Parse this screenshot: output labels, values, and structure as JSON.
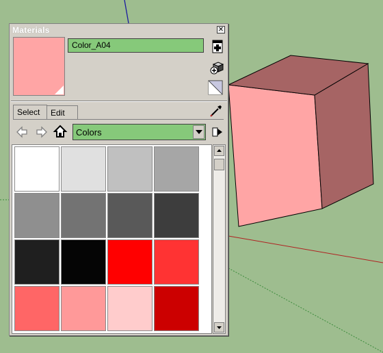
{
  "panel": {
    "title": "Materials",
    "material_name": "Color_A04",
    "current_color": "#ffa5a5"
  },
  "tabs": [
    {
      "label": "Select",
      "active": true
    },
    {
      "label": "Edit",
      "active": false
    }
  ],
  "collection": {
    "selected": "Colors"
  },
  "swatches": [
    "#ffffff",
    "#e0e0e0",
    "#c0c0c0",
    "#a6a6a6",
    "#8f8f8f",
    "#737373",
    "#595959",
    "#3d3d3d",
    "#1f1f1f",
    "#050505",
    "#ff0000",
    "#ff3333",
    "#ff6666",
    "#ff9999",
    "#ffcccc",
    "#cc0000"
  ],
  "scene": {
    "background": "#9ebd8f",
    "box_front": "#ffa5a5",
    "box_side": "#a66464",
    "box_top": "#a66464"
  },
  "icons": {
    "close": "close-icon",
    "create_material": "create-material-icon",
    "model_materials": "model-materials-icon",
    "default_material": "default-material-icon",
    "sample_paint": "eyedropper-icon",
    "back": "back-arrow-icon",
    "forward": "forward-arrow-icon",
    "home": "home-icon",
    "details": "details-arrow-icon"
  }
}
